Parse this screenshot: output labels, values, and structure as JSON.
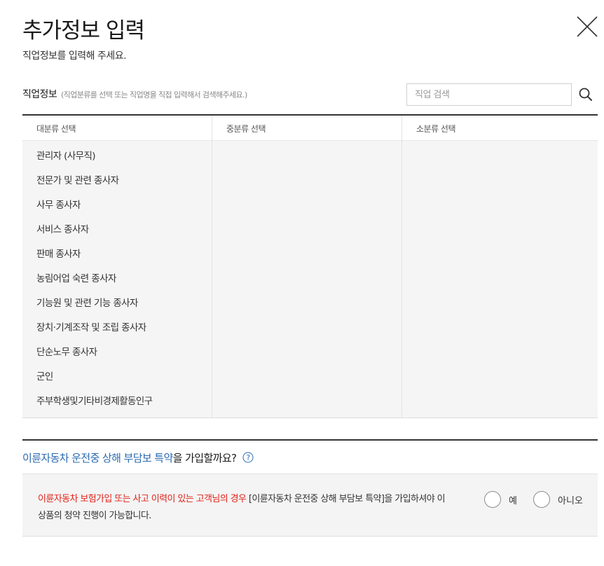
{
  "header": {
    "title": "추가정보 입력",
    "subtitle": "직업정보를 입력해 주세요.",
    "close_icon": "close-icon"
  },
  "job": {
    "label": "직업정보",
    "hint": "(직업분류를 선택 또는 직업명을 직접 입력해서 검색해주세요.)",
    "search_placeholder": "직업 검색",
    "search_icon": "search-icon"
  },
  "columns": {
    "major": "대분류 선택",
    "middle": "중분류 선택",
    "minor": "소분류 선택"
  },
  "major_categories": [
    "관리자 (사무직)",
    "전문가 및 관련 종사자",
    "사무 종사자",
    "서비스 종사자",
    "판매 종사자",
    "농림어업 숙련 종사자",
    "기능원 및 관련 기능 종사자",
    "장치·기계조작 및 조립 종사자",
    "단순노무 종사자",
    "군인",
    "주부학생및기타비경제활동인구"
  ],
  "rider": {
    "question_highlight": "이륜자동차 운전중 상해 부담보 특약",
    "question_rest": "을 가입할까요?",
    "help_icon": "question-circle-icon",
    "notice_red": "이륜자동차 보험가입 또는 사고 이력이 있는 고객님의 경우",
    "notice_rest": " [이륜자동차 운전중 상해 부담보 특약]을 가입하셔야 이 상품의 청약 진행이 가능합니다.",
    "option_yes": "예",
    "option_no": "아니오"
  },
  "colors": {
    "accent_blue": "#2a6ab0",
    "warning_red": "#e2231a",
    "panel_gray": "#f5f5f5"
  }
}
